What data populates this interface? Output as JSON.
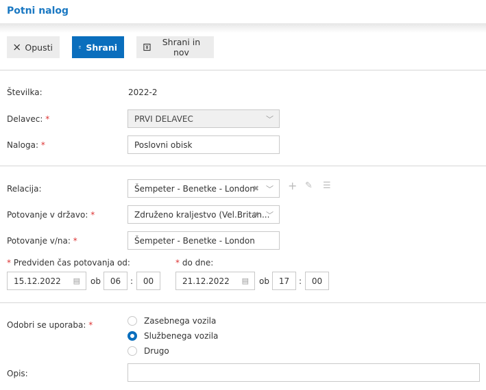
{
  "header": {
    "title": "Potni nalog"
  },
  "toolbar": {
    "cancel": "Opusti",
    "save": "Shrani",
    "save_new": "Shrani in nov"
  },
  "form": {
    "stevilka": {
      "label": "Številka:",
      "value": "2022-2"
    },
    "delavec": {
      "label": "Delavec:",
      "value": "PRVI DELAVEC"
    },
    "naloga": {
      "label": "Naloga:",
      "value": "Poslovni obisk"
    },
    "relacija": {
      "label": "Relacija:",
      "value": "Šempeter - Benetke - London"
    },
    "drzava": {
      "label": "Potovanje v državo:",
      "value": "Združeno kraljestvo (Vel.Britan..."
    },
    "potovanje_vna": {
      "label": "Potovanje v/na:",
      "value": "Šempeter - Benetke - London"
    },
    "od": {
      "label": "Predviden čas potovanja od:",
      "date": "15.12.2022",
      "ob": "ob",
      "hour": "06",
      "sep": ":",
      "minute": "00"
    },
    "do": {
      "label": "do dne:",
      "date": "21.12.2022",
      "ob": "ob",
      "hour": "17",
      "sep": ":",
      "minute": "00"
    },
    "uporaba": {
      "label": "Odobri se uporaba:",
      "options": [
        "Zasebnega vozila",
        "Službenega vozila",
        "Drugo"
      ],
      "selected": "Službenega vozila"
    },
    "opis": {
      "label": "Opis:",
      "value": ""
    },
    "required_mark": "*"
  },
  "colors": {
    "accent": "#0a6ebd",
    "title": "#1a78c2",
    "required": "#dd3333"
  }
}
